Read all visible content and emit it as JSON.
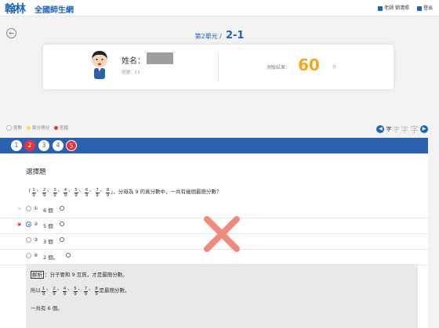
{
  "header": {
    "logo_mark": "翰林",
    "logo_text": "全國師生網",
    "teacher_label": "老師 劉清照",
    "logout_label": "登出"
  },
  "breadcrumb": {
    "unit": "第2單元 /",
    "lesson": "2-1"
  },
  "student_card": {
    "name_label": "姓名：",
    "seat_label": "座號：13",
    "score_label": "測驗結果：",
    "score_value": "60",
    "score_unit": "分"
  },
  "legend": {
    "correct": "答對",
    "partial": "部分得分",
    "wrong": "答錯"
  },
  "font_size": {
    "label": "字",
    "options": [
      "字",
      "字",
      "字"
    ]
  },
  "question_nav": [
    "1",
    "2",
    "3",
    "4",
    "5"
  ],
  "question": {
    "type_title": "選擇題",
    "open_quote": "「",
    "fractions": [
      "1",
      "2",
      "3",
      "4",
      "5",
      "6",
      "7",
      "8"
    ],
    "denominator": "9",
    "sep": "、",
    "close_text": "」，分母為 9 的真分數中，一共有幾個最簡分數？",
    "options": [
      {
        "num": "①",
        "text": "6 個"
      },
      {
        "num": "②",
        "text": "5 個"
      },
      {
        "num": "③",
        "text": "3 個"
      },
      {
        "num": "④",
        "text": "2 個。"
      }
    ],
    "correct_marker": "☞",
    "wrong_marker": "✖"
  },
  "explanation": {
    "tag": "解析",
    "line1": "：分子要和 9 互質，才是最簡分數。",
    "line2_prefix": "所以",
    "line2_fractions": [
      "1",
      "2",
      "4",
      "5",
      "7",
      "8"
    ],
    "line2_suffix": "是最簡分數。",
    "line3": "一共有 6 個。"
  },
  "colors": {
    "brand": "#1d63b8",
    "score": "#f5a623",
    "wrong": "#e8333c",
    "nav_bar": "#2a62b0"
  }
}
